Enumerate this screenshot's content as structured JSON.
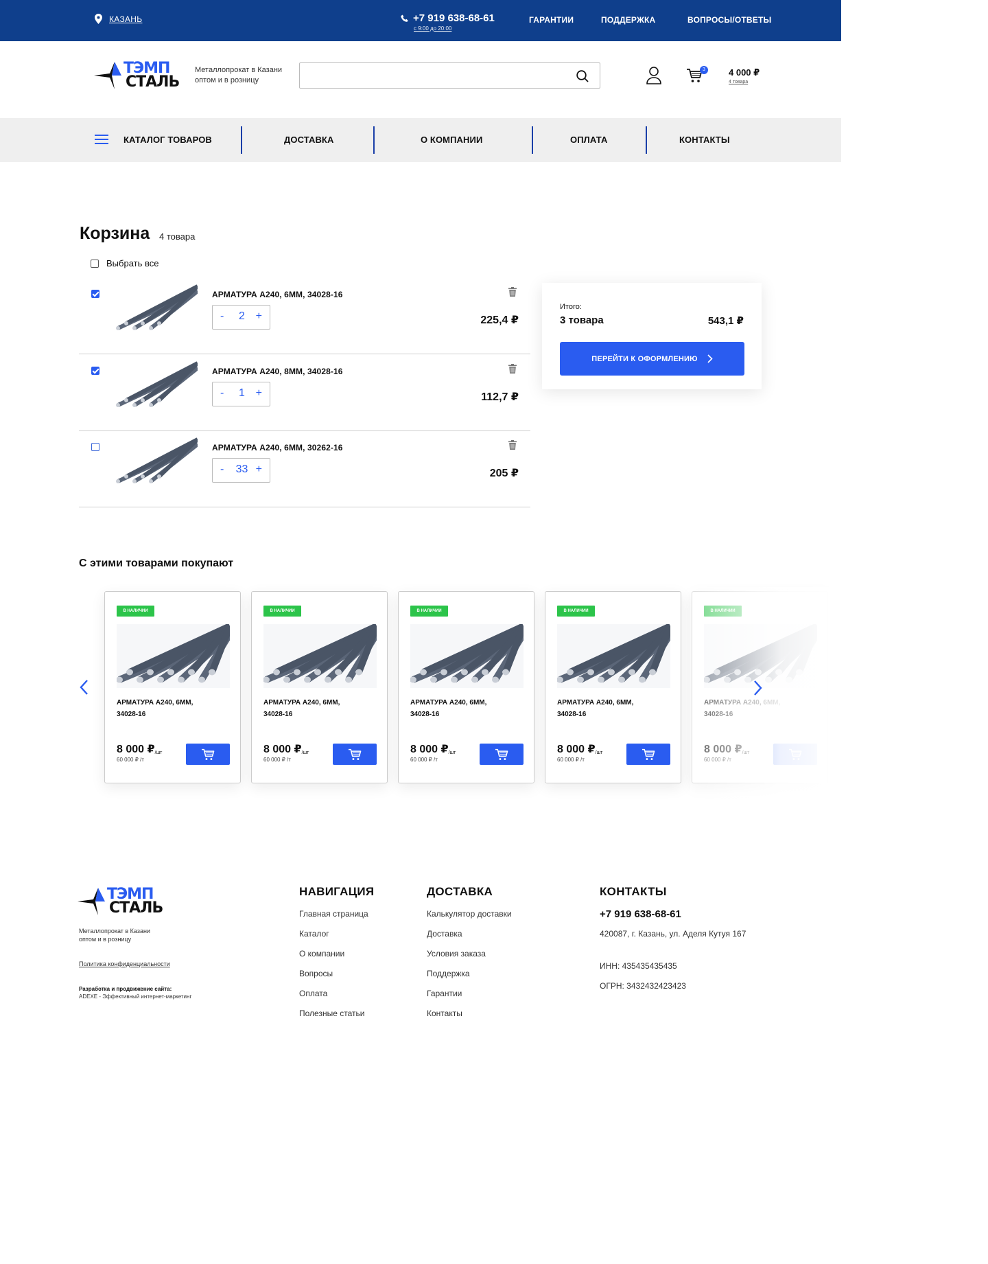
{
  "topbar": {
    "city": "КАЗАНЬ",
    "phone": "+7 919 638-68-61",
    "hours": "с 9:00 до 20:00",
    "links": [
      "ГАРАНТИИ",
      "ПОДДЕРЖКА",
      "ВОПРОСЫ/ОТВЕТЫ"
    ]
  },
  "header": {
    "logo_line1": "ТЭМП",
    "logo_line2": "СТАЛЬ",
    "tagline1": "Металлопрокат в Казани",
    "tagline2": "оптом и в розницу",
    "search": {
      "value": "",
      "placeholder": ""
    },
    "cart_badge": "3",
    "cart_sum": "4 000 ₽",
    "cart_count": "4 товара"
  },
  "nav": {
    "items": [
      "КАТАЛОГ ТОВАРОВ",
      "ДОСТАВКА",
      "О КОМПАНИИ",
      "ОПЛАТА",
      "КОНТАКТЫ"
    ]
  },
  "cart": {
    "title": "Корзина",
    "count": "4 товара",
    "select_all": "Выбрать все",
    "items": [
      {
        "name": "АРМАТУРА А240, 6ММ, 34028-16",
        "qty": "2",
        "price": "225,4 ₽",
        "checked": true
      },
      {
        "name": "АРМАТУРА А240, 8ММ, 34028-16",
        "qty": "1",
        "price": "112,7 ₽",
        "checked": true
      },
      {
        "name": "АРМАТУРА А240, 6ММ, 30262-16",
        "qty": "33",
        "price": "205 ₽",
        "checked": false
      }
    ],
    "qty_minus": "-",
    "qty_plus": "+"
  },
  "summary": {
    "label": "Итого:",
    "count": "3 товара",
    "total": "543,1 ₽",
    "checkout": "ПЕРЕЙТИ К ОФОРМЛЕНИЮ"
  },
  "recommend": {
    "title": "С этими товарами покупают",
    "products": [
      {
        "badge": "В НАЛИЧИИ",
        "name1": "АРМАТУРА А240, 6ММ,",
        "name2": "34028-16",
        "price": "8 000 ₽",
        "unit": "/шт",
        "per": "60 000 ₽ /т"
      },
      {
        "badge": "В НАЛИЧИИ",
        "name1": "АРМАТУРА А240, 6ММ,",
        "name2": "34028-16",
        "price": "8 000 ₽",
        "unit": "/шт",
        "per": "60 000 ₽ /т"
      },
      {
        "badge": "В НАЛИЧИИ",
        "name1": "АРМАТУРА А240, 6ММ,",
        "name2": "34028-16",
        "price": "8 000 ₽",
        "unit": "/шт",
        "per": "60 000 ₽ /т"
      },
      {
        "badge": "В НАЛИЧИИ",
        "name1": "АРМАТУРА А240, 6ММ,",
        "name2": "34028-16",
        "price": "8 000 ₽",
        "unit": "/шт",
        "per": "60 000 ₽ /т"
      },
      {
        "badge": "В НАЛИЧИИ",
        "name1": "АРМАТУРА А240, 6ММ,",
        "name2": "34028-16",
        "price": "8 000 ₽",
        "unit": "/шт",
        "per": "60 000 ₽ /т"
      }
    ]
  },
  "footer": {
    "tagline1": "Металлопрокат в Казани",
    "tagline2": "оптом и в розницу",
    "policy": "Политика конфиденциальности",
    "dev_title": "Разработка и продвижение сайта:",
    "dev_text": "ADEXE - Эффективный интернет-маркетинг",
    "nav_title": "НАВИГАЦИЯ",
    "nav_links": [
      "Главная страница",
      "Каталог",
      "О компании",
      "Вопросы",
      "Оплата",
      "Полезные статьи"
    ],
    "delivery_title": "ДОСТАВКА",
    "delivery_links": [
      "Калькулятор доставки",
      "Доставка",
      "Условия заказа",
      "Поддержка",
      "Гарантии",
      "Контакты"
    ],
    "contacts_title": "КОНТАКТЫ",
    "phone": "+7 919 638-68-61",
    "address": "420087, г. Казань, ул. Аделя Кутуя 167",
    "inn": "ИНН: 435435435435",
    "ogrn": "ОГРН: 3432432423423"
  },
  "colors": {
    "brand": "#0f3f8c",
    "accent": "#2a5cf0",
    "stock": "#2cc44a"
  }
}
